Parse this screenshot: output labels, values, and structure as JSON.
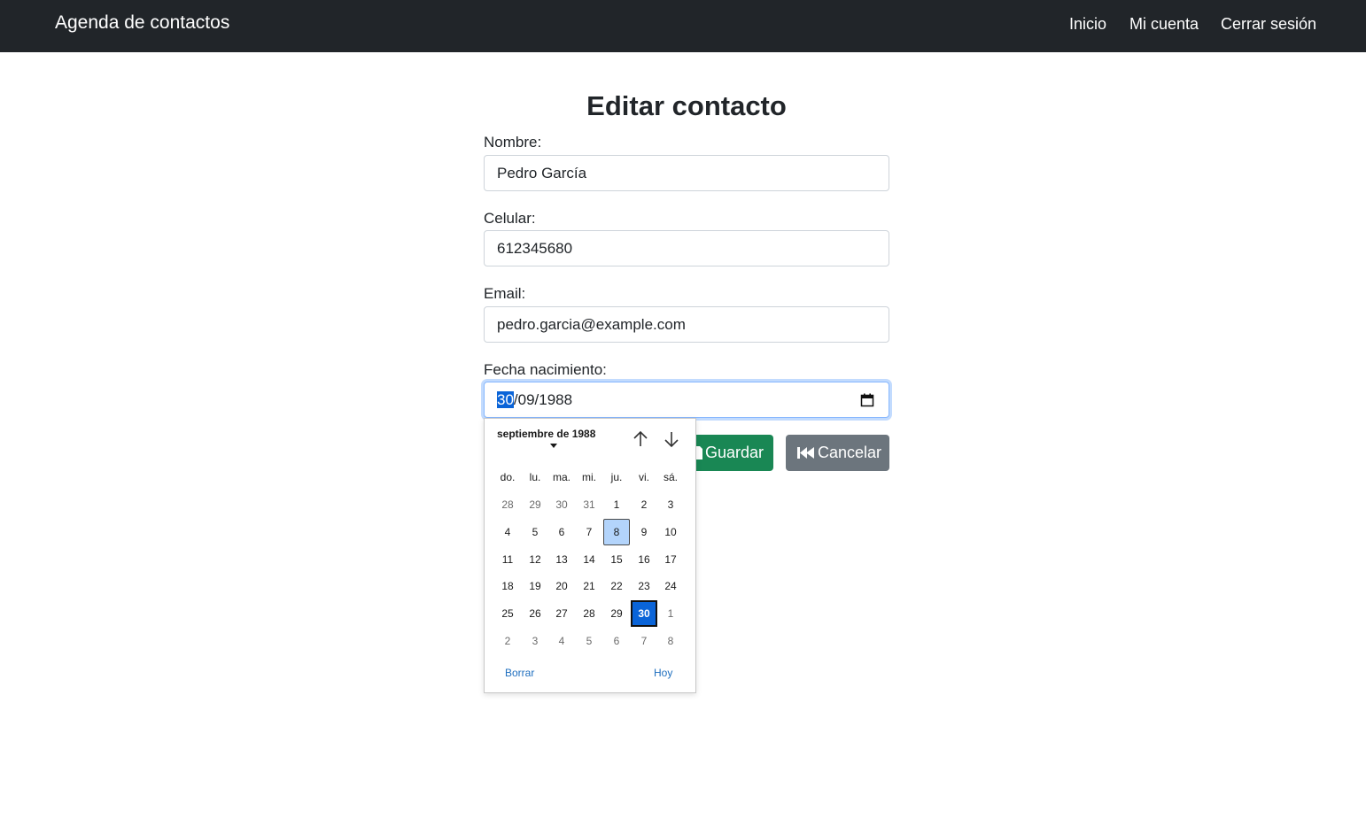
{
  "navbar": {
    "brand": "Agenda de contactos",
    "links": [
      "Inicio",
      "Mi cuenta",
      "Cerrar sesión"
    ]
  },
  "form": {
    "title": "Editar contacto",
    "nombre_label": "Nombre:",
    "nombre_value": "Pedro García",
    "celular_label": "Celular:",
    "celular_value": "612345680",
    "email_label": "Email:",
    "email_value": "pedro.garcia@example.com",
    "fecha_label": "Fecha nacimiento:",
    "fecha_day": "30",
    "fecha_rest": "/09/1988",
    "save_label": "Guardar",
    "cancel_label": "Cancelar"
  },
  "datepicker": {
    "month_label": "septiembre de 1988",
    "weekdays": [
      "do.",
      "lu.",
      "ma.",
      "mi.",
      "ju.",
      "vi.",
      "sá."
    ],
    "weeks": [
      [
        "28",
        "29",
        "30",
        "31",
        "1",
        "2",
        "3"
      ],
      [
        "4",
        "5",
        "6",
        "7",
        "8",
        "9",
        "10"
      ],
      [
        "11",
        "12",
        "13",
        "14",
        "15",
        "16",
        "17"
      ],
      [
        "18",
        "19",
        "20",
        "21",
        "22",
        "23",
        "24"
      ],
      [
        "25",
        "26",
        "27",
        "28",
        "29",
        "30",
        "1"
      ],
      [
        "2",
        "3",
        "4",
        "5",
        "6",
        "7",
        "8"
      ]
    ],
    "clear_label": "Borrar",
    "today_label": "Hoy"
  },
  "colors": {
    "navbar": "#212529",
    "save_button": "#198754",
    "cancel_button": "#6c757d",
    "selected_day": "#0a64d8",
    "today_day": "#b3d4fb",
    "link": "#1f6fbf"
  }
}
